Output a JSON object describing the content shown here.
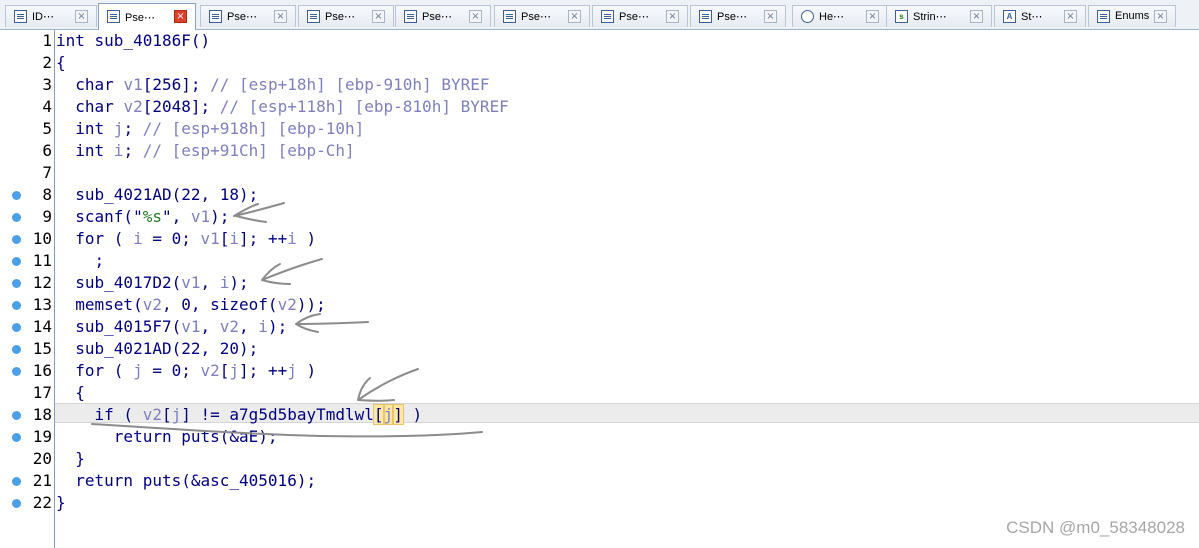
{
  "tabs": [
    {
      "label": "ID⋯",
      "icon": "ida-view-icon",
      "active": false
    },
    {
      "label": "Pse⋯",
      "icon": "pseudocode-icon",
      "active": true
    },
    {
      "label": "Pse⋯",
      "icon": "pseudocode-icon",
      "active": false
    },
    {
      "label": "Pse⋯",
      "icon": "pseudocode-icon",
      "active": false
    },
    {
      "label": "Pse⋯",
      "icon": "pseudocode-icon",
      "active": false
    },
    {
      "label": "Pse⋯",
      "icon": "pseudocode-icon",
      "active": false
    },
    {
      "label": "Pse⋯",
      "icon": "pseudocode-icon",
      "active": false
    },
    {
      "label": "Pse⋯",
      "icon": "pseudocode-icon",
      "active": false
    },
    {
      "label": "He⋯",
      "icon": "hex-view-icon",
      "active": false
    },
    {
      "label": "Strin⋯",
      "icon": "strings-icon",
      "active": false
    },
    {
      "label": "St⋯",
      "icon": "structures-icon",
      "active": false
    },
    {
      "label": "Enums",
      "icon": "enums-icon",
      "active": false
    }
  ],
  "tab_close_glyph": "×",
  "lines": [
    {
      "num": "1",
      "dot": false,
      "code": "int sub_40186F()"
    },
    {
      "num": "2",
      "dot": false,
      "code": "{"
    },
    {
      "num": "3",
      "dot": false,
      "code": "  char v1[256]; // [esp+18h] [ebp-910h] BYREF"
    },
    {
      "num": "4",
      "dot": false,
      "code": "  char v2[2048]; // [esp+118h] [ebp-810h] BYREF"
    },
    {
      "num": "5",
      "dot": false,
      "code": "  int j; // [esp+918h] [ebp-10h]"
    },
    {
      "num": "6",
      "dot": false,
      "code": "  int i; // [esp+91Ch] [ebp-Ch]"
    },
    {
      "num": "7",
      "dot": false,
      "code": ""
    },
    {
      "num": "8",
      "dot": true,
      "code": "  sub_4021AD(22, 18);"
    },
    {
      "num": "9",
      "dot": true,
      "code": "  scanf(\"%s\", v1);"
    },
    {
      "num": "10",
      "dot": true,
      "code": "  for ( i = 0; v1[i]; ++i )"
    },
    {
      "num": "11",
      "dot": true,
      "code": "    ;"
    },
    {
      "num": "12",
      "dot": true,
      "code": "  sub_4017D2(v1, i);"
    },
    {
      "num": "13",
      "dot": true,
      "code": "  memset(v2, 0, sizeof(v2));"
    },
    {
      "num": "14",
      "dot": true,
      "code": "  sub_4015F7(v1, v2, i);"
    },
    {
      "num": "15",
      "dot": true,
      "code": "  sub_4021AD(22, 20);"
    },
    {
      "num": "16",
      "dot": true,
      "code": "  for ( j = 0; v2[j]; ++j )"
    },
    {
      "num": "17",
      "dot": false,
      "code": "  {"
    },
    {
      "num": "18",
      "dot": true,
      "code": "    if ( v2[j] != a7g5d5bayTmdlwl[j] )",
      "highlighted": true
    },
    {
      "num": "19",
      "dot": true,
      "code": "      return puts(&aE);"
    },
    {
      "num": "20",
      "dot": false,
      "code": "  }"
    },
    {
      "num": "21",
      "dot": true,
      "code": "  return puts(&asc_405016);"
    },
    {
      "num": "22",
      "dot": true,
      "code": "}"
    }
  ],
  "selected_token": "j",
  "watermark": "CSDN @m0_58348028",
  "colors": {
    "keyword": "#00007f",
    "comment": "#7f7fbf",
    "string": "#1e7d1e",
    "breakpoint_dot": "#4a9fe6",
    "active_tab_close": "#d9412b"
  }
}
